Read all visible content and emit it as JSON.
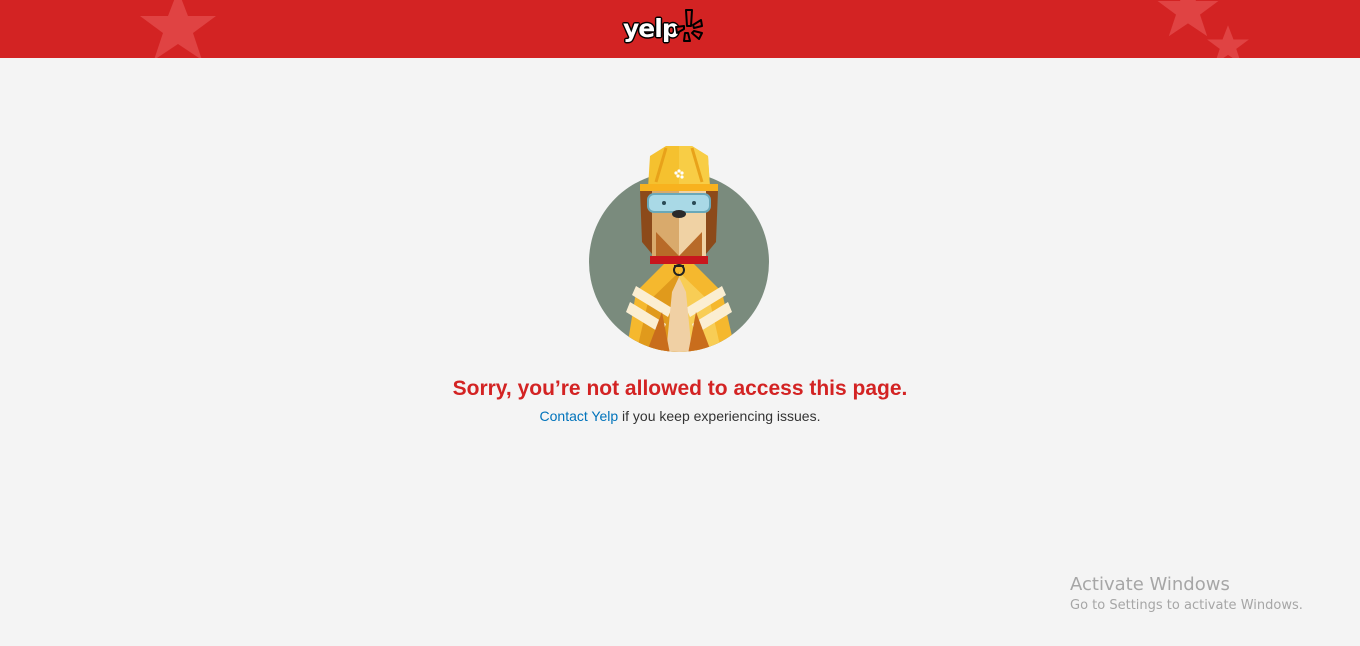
{
  "header": {
    "logo_text": "yelp",
    "brand_color": "#d32323"
  },
  "illustration": {
    "icon": "construction-dog-illustration"
  },
  "message": {
    "title": "Sorry, you’re not allowed to access this page.",
    "contact_link": "Contact Yelp",
    "contact_suffix": " if you keep experiencing issues.",
    "link_color": "#0073bb"
  },
  "watermark": {
    "title": "Activate Windows",
    "subtitle": "Go to Settings to activate Windows."
  }
}
